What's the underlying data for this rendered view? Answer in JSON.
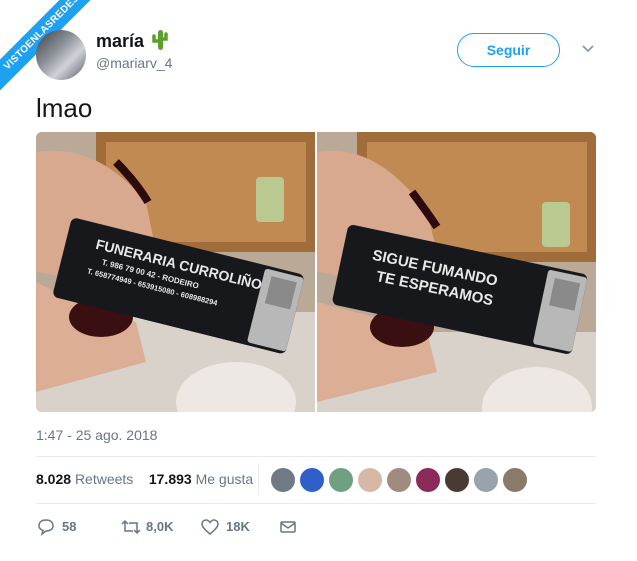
{
  "watermark": "VISTOENLASREDES",
  "author": {
    "name": "maría",
    "handle": "@mariarv_4",
    "emoji_icon": "cactus-icon"
  },
  "follow_label": "Seguir",
  "tweet_text": "lmao",
  "photos": [
    {
      "caption_lines": [
        "FUNERARIA CURROLIÑO",
        "T. 986 79 00 42 - RODEIRO",
        "T. 658774949 - 653915080 - 608988294"
      ]
    },
    {
      "caption_lines": [
        "SIGUE FUMANDO",
        "TE ESPERAMOS"
      ]
    }
  ],
  "timestamp": "1:47 - 25 ago. 2018",
  "stats": {
    "retweets_count": "8.028",
    "retweets_label": "Retweets",
    "likes_count": "17.893",
    "likes_label": "Me gusta"
  },
  "actions": {
    "replies": "58",
    "retweets": "8,0K",
    "likes": "18K"
  },
  "colors": {
    "accent": "#1da1f2",
    "muted": "#657786",
    "text": "#14171a"
  }
}
